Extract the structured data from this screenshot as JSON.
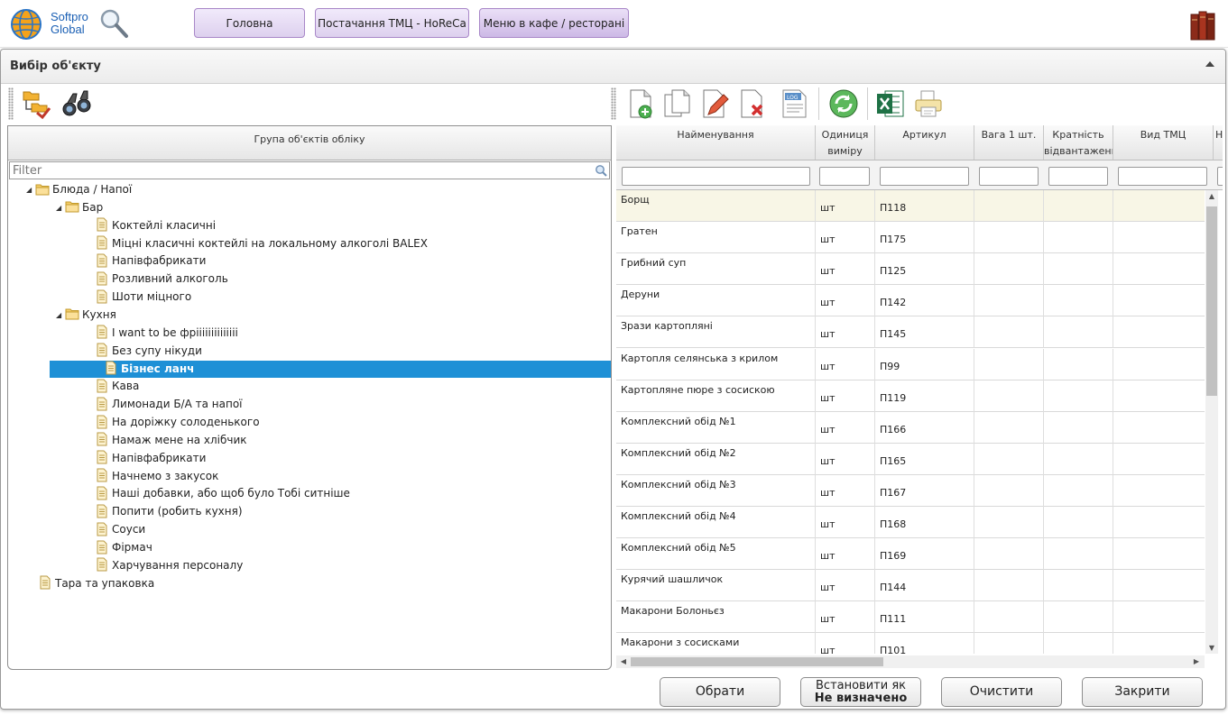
{
  "header": {
    "logo_line1": "Softpro",
    "logo_line2": "Global",
    "nav": [
      {
        "label": "Головна"
      },
      {
        "label": "Постачання ТМЦ - HoReCa"
      },
      {
        "label": "Меню в кафе / ресторані"
      }
    ]
  },
  "window": {
    "title": "Вибір об'єкту"
  },
  "tree_panel": {
    "header": "Група об'єктів обліку",
    "filter_placeholder": "Filter",
    "nodes": [
      {
        "label": "Блюда / Напої"
      },
      {
        "label": "Бар"
      },
      {
        "label": "Коктейлі класичні"
      },
      {
        "label": "Міцні класичні коктейлі на локальному алкоголі BALEX"
      },
      {
        "label": "Напівфабрикати"
      },
      {
        "label": "Розливний алкоголь"
      },
      {
        "label": "Шоти міцного"
      },
      {
        "label": "Кухня"
      },
      {
        "label": "I want to be фріііііііііііііі"
      },
      {
        "label": "Без супу нікуди"
      },
      {
        "label": "Бізнес ланч"
      },
      {
        "label": "Кава"
      },
      {
        "label": "Лимонади Б/А та напої"
      },
      {
        "label": "На доріжку солоденького"
      },
      {
        "label": "Намаж мене на хлібчик"
      },
      {
        "label": "Напівфабрикати"
      },
      {
        "label": "Начнемо з закусок"
      },
      {
        "label": "Наші добавки, або щоб було Тобі ситніше"
      },
      {
        "label": "Попити (робить кухня)"
      },
      {
        "label": "Соуси"
      },
      {
        "label": "Фірмач"
      },
      {
        "label": "Харчування персоналу"
      },
      {
        "label": "Тара та упаковка"
      }
    ]
  },
  "grid": {
    "columns": [
      {
        "label": "Найменування"
      },
      {
        "label": "Одиниця виміру"
      },
      {
        "label": "Артикул"
      },
      {
        "label": "Вага 1 шт."
      },
      {
        "label": "Кратність відвантаження"
      },
      {
        "label": "Вид ТМЦ"
      },
      {
        "label": "Н"
      }
    ],
    "rows": [
      {
        "name": "Борщ",
        "unit": "шт",
        "sku": "П118"
      },
      {
        "name": "Гратен",
        "unit": "шт",
        "sku": "П175"
      },
      {
        "name": "Грибний суп",
        "unit": "шт",
        "sku": "П125"
      },
      {
        "name": "Деруни",
        "unit": "шт",
        "sku": "П142"
      },
      {
        "name": "Зрази картопляні",
        "unit": "шт",
        "sku": "П145"
      },
      {
        "name": "Картопля селянська з крилом",
        "unit": "шт",
        "sku": "П99"
      },
      {
        "name": "Картопляне пюре з сосискою",
        "unit": "шт",
        "sku": "П119"
      },
      {
        "name": "Комплексний обід №1",
        "unit": "шт",
        "sku": "П166"
      },
      {
        "name": "Комплексний обід №2",
        "unit": "шт",
        "sku": "П165"
      },
      {
        "name": "Комплексний обід №3",
        "unit": "шт",
        "sku": "П167"
      },
      {
        "name": "Комплексний обід №4",
        "unit": "шт",
        "sku": "П168"
      },
      {
        "name": "Комплексний обід №5",
        "unit": "шт",
        "sku": "П169"
      },
      {
        "name": "Курячий шашличок",
        "unit": "шт",
        "sku": "П144"
      },
      {
        "name": "Макарони Болоньєз",
        "unit": "шт",
        "sku": "П111"
      },
      {
        "name": "Макарони з сосисками",
        "unit": "шт",
        "sku": "П101"
      }
    ]
  },
  "buttons": {
    "select": "Обрати",
    "set_as_line1": "Встановити як",
    "set_as_line2": "Не визначено",
    "clear": "Очистити",
    "close": "Закрити"
  },
  "colors": {
    "selection": "#1e90d6",
    "nav_border": "#a887c8",
    "logo_text": "#1a5fb4",
    "first_row_bg": "#f8f6e6"
  },
  "icons": {
    "left_toolbar": [
      "folders-hierarchy-icon",
      "binoculars-icon"
    ],
    "right_toolbar": [
      "new-document-icon",
      "copy-document-icon",
      "edit-document-icon",
      "delete-document-icon",
      "log-icon",
      "refresh-icon",
      "excel-icon",
      "printer-icon"
    ]
  }
}
